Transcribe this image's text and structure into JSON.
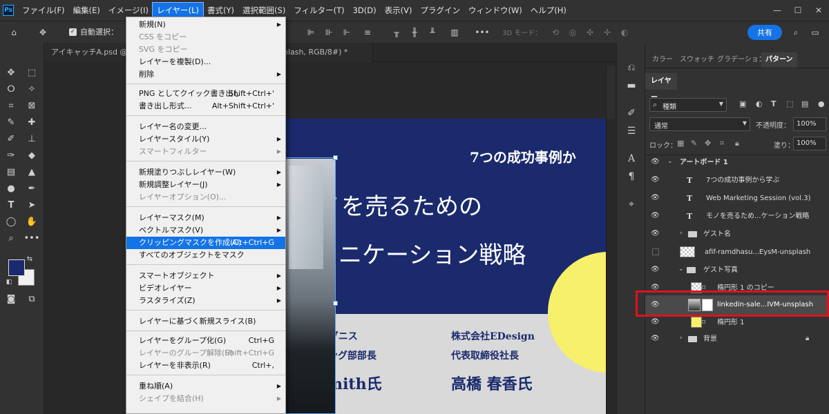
{
  "menubar": {
    "logo": "Ps",
    "items": [
      "ファイル(F)",
      "編集(E)",
      "イメージ(I)",
      "レイヤー(L)",
      "書式(Y)",
      "選択範囲(S)",
      "フィルター(T)",
      "3D(D)",
      "表示(V)",
      "プラグイン",
      "ウィンドウ(W)",
      "ヘルプ(H)"
    ],
    "active_index": 3
  },
  "optionsbar": {
    "auto_select_label": "自動選択：",
    "mode_3d_label": "3D モード：",
    "share_label": "共有"
  },
  "tabs": [
    {
      "label": "アイキャッチA.psd @ 70"
    },
    {
      "label": "plash, RGB/8#) *"
    }
  ],
  "dropdown": {
    "items": [
      {
        "label": "新規(N)",
        "shortcut": "",
        "submenu": true,
        "disabled": false
      },
      {
        "label": "CSS をコピー",
        "shortcut": "",
        "submenu": false,
        "disabled": true
      },
      {
        "label": "SVG をコピー",
        "shortcut": "",
        "submenu": false,
        "disabled": true
      },
      {
        "label": "レイヤーを複製(D)...",
        "shortcut": "",
        "submenu": false,
        "disabled": false
      },
      {
        "label": "削除",
        "shortcut": "",
        "submenu": true,
        "disabled": false
      },
      {
        "label": "PNG としてクイック書き出し",
        "shortcut": "Shift+Ctrl+'",
        "submenu": false,
        "disabled": false
      },
      {
        "label": "書き出し形式...",
        "shortcut": "Alt+Shift+Ctrl+'",
        "submenu": false,
        "disabled": false
      },
      {
        "label": "レイヤー名の変更...",
        "shortcut": "",
        "submenu": false,
        "disabled": false
      },
      {
        "label": "レイヤースタイル(Y)",
        "shortcut": "",
        "submenu": true,
        "disabled": false
      },
      {
        "label": "スマートフィルター",
        "shortcut": "",
        "submenu": true,
        "disabled": true
      },
      {
        "label": "新規塗りつぶしレイヤー(W)",
        "shortcut": "",
        "submenu": true,
        "disabled": false
      },
      {
        "label": "新規調整レイヤー(J)",
        "shortcut": "",
        "submenu": true,
        "disabled": false
      },
      {
        "label": "レイヤーオプション(O)...",
        "shortcut": "",
        "submenu": false,
        "disabled": true
      },
      {
        "label": "レイヤーマスク(M)",
        "shortcut": "",
        "submenu": true,
        "disabled": false
      },
      {
        "label": "ベクトルマスク(V)",
        "shortcut": "",
        "submenu": true,
        "disabled": false
      },
      {
        "label": "クリッピングマスクを作成(C)",
        "shortcut": "Alt+Ctrl+G",
        "submenu": false,
        "disabled": false,
        "highlight": true
      },
      {
        "label": "すべてのオブジェクトをマスク",
        "shortcut": "",
        "submenu": false,
        "disabled": false
      },
      {
        "label": "スマートオブジェクト",
        "shortcut": "",
        "submenu": true,
        "disabled": false
      },
      {
        "label": "ビデオレイヤー",
        "shortcut": "",
        "submenu": true,
        "disabled": false
      },
      {
        "label": "ラスタライズ(Z)",
        "shortcut": "",
        "submenu": true,
        "disabled": false
      },
      {
        "label": "レイヤーに基づく新規スライス(B)",
        "shortcut": "",
        "submenu": false,
        "disabled": false
      },
      {
        "label": "レイヤーをグループ化(G)",
        "shortcut": "Ctrl+G",
        "submenu": false,
        "disabled": false
      },
      {
        "label": "レイヤーのグループ解除(U)",
        "shortcut": "Shift+Ctrl+G",
        "submenu": false,
        "disabled": true
      },
      {
        "label": "レイヤーを非表示(R)",
        "shortcut": "Ctrl+,",
        "submenu": false,
        "disabled": false
      },
      {
        "label": "重ね順(A)",
        "shortcut": "",
        "submenu": true,
        "disabled": false
      },
      {
        "label": "シェイプを結合(H)",
        "shortcut": "",
        "submenu": true,
        "disabled": true
      }
    ]
  },
  "artwork": {
    "top_right": "7つの成功事例か",
    "headline_1": "モノを売るための",
    "headline_2": "ミュニケーション戦略",
    "left_company": "式会社イグニス",
    "left_title": "ーケティング部部長",
    "left_name": "ke Smith氏",
    "right_company": "株式会社EDesign",
    "right_title": "代表取締役社長",
    "right_name": "高橋 春香氏"
  },
  "right_panel": {
    "tabs": [
      "カラー",
      "スウォッチ",
      "グラデーション",
      "パターン"
    ],
    "active_tab": "パターン",
    "layers_tab": "レイヤー",
    "filter_label": "種類",
    "blend_mode": "通常",
    "opacity_label": "不透明度：",
    "opacity_value": "100%",
    "lock_label": "ロック：",
    "fill_label": "塗り：",
    "fill_value": "100%",
    "layers": [
      {
        "name": "アートボード 1",
        "kind": "artboard"
      },
      {
        "name": "7つの成功事例から学ぶ",
        "kind": "text"
      },
      {
        "name": "Web Marketing Session (vol.3)",
        "kind": "text"
      },
      {
        "name": "モノを売るため...ケーション戦略",
        "kind": "text"
      },
      {
        "name": "ゲスト名",
        "kind": "group"
      },
      {
        "name": "afif-ramdhasu...EysM-unsplash",
        "kind": "image"
      },
      {
        "name": "ゲスト写真",
        "kind": "group-open"
      },
      {
        "name": "楕円形 1 のコピー",
        "kind": "shape"
      },
      {
        "name": "linkedin-sale...IVM-unsplash",
        "kind": "image",
        "selected": true
      },
      {
        "name": "楕円形 1",
        "kind": "shape"
      },
      {
        "name": "背景",
        "kind": "group"
      }
    ]
  },
  "colors": {
    "accent": "#1473e6",
    "highlight_box": "#e0121b",
    "artboard_blue": "#1a2a6c",
    "yellow": "#f7f06a",
    "foreground_swatch": "#1a2a6c"
  }
}
